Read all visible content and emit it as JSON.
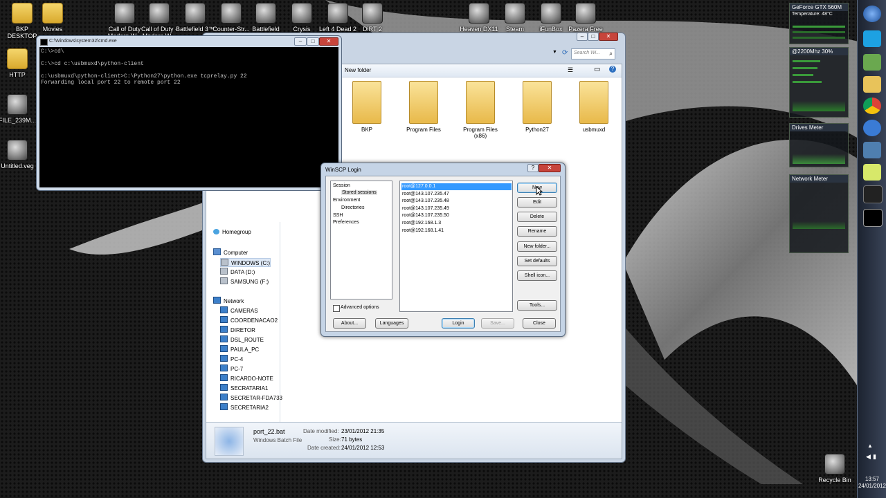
{
  "desktop": {
    "icons": [
      {
        "label": "BKP\nDESKTOP",
        "kind": "folder"
      },
      {
        "label": "Movies",
        "kind": "folder"
      },
      {
        "label": "Call of Duty\nModern W...",
        "kind": "app"
      },
      {
        "label": "Call of Duty -\nModern W...",
        "kind": "app"
      },
      {
        "label": "Battlefield 3™",
        "kind": "app"
      },
      {
        "label": "Counter-Str...",
        "kind": "app"
      },
      {
        "label": "Battlefield",
        "kind": "app"
      },
      {
        "label": "Crysis",
        "kind": "app"
      },
      {
        "label": "Left 4 Dead 2",
        "kind": "app"
      },
      {
        "label": "DiRT 2",
        "kind": "app"
      },
      {
        "label": "Heaven DX11",
        "kind": "app"
      },
      {
        "label": "Steam",
        "kind": "app"
      },
      {
        "label": "iFunBox",
        "kind": "app"
      },
      {
        "label": "Pazera Free\n...",
        "kind": "app"
      },
      {
        "label": "HTTP",
        "kind": "folder"
      },
      {
        "label": "FILE_239M...",
        "kind": "app"
      },
      {
        "label": "Untitled.veg",
        "kind": "app"
      },
      {
        "label": "Recycle Bin",
        "kind": "app"
      }
    ]
  },
  "cmd": {
    "title": "C:\\Windows\\system32\\cmd.exe",
    "lines": "C:\\>cd\\\n\nC:\\>cd c:\\usbmuxd\\python-client\n\nc:\\usbmuxd\\python-client>C:\\Python27\\python.exe tcprelay.py 22\nForwarding local port 22 to remote port 22"
  },
  "explorer": {
    "search_placeholder": "Search Wi...",
    "new_folder": "New folder",
    "folders": [
      "BKP",
      "Program Files",
      "Program Files\n(x86)",
      "Python27",
      "usbmuxd"
    ],
    "nav": {
      "homegroup": "Homegroup",
      "computer": "Computer",
      "drives": [
        "WINDOWS (C:)",
        "DATA (D:)",
        "SAMSUNG (F:)"
      ],
      "network": "Network",
      "hosts": [
        "CAMERAS",
        "COORDENACAO2",
        "DIRETOR",
        "DSL_ROUTE",
        "PAULA_PC",
        "PC-4",
        "PC-7",
        "RICARDO-NOTE",
        "SECRATARIA1",
        "SECRETAR-FDA733",
        "SECRETARIA2"
      ]
    },
    "details": {
      "name": "port_22.bat",
      "type": "Windows Batch File",
      "modified_label": "Date modified:",
      "modified": "23/01/2012 21:35",
      "size_label": "Size:",
      "size": "71 bytes",
      "created_label": "Date created:",
      "created": "24/01/2012 12:53"
    }
  },
  "winscp": {
    "title": "WinSCP Login",
    "tree": {
      "session": "Session",
      "stored": "Stored sessions",
      "environment": "Environment",
      "directories": "Directories",
      "ssh": "SSH",
      "preferences": "Preferences"
    },
    "sessions": [
      "root@127.0.0.1",
      "root@143.107.235.47",
      "root@143.107.235.48",
      "root@143.107.235.49",
      "root@143.107.235.50",
      "root@192.168.1.3",
      "root@192.168.1.41"
    ],
    "selected_index": 0,
    "buttons": {
      "new": "New",
      "edit": "Edit",
      "delete": "Delete",
      "rename": "Rename",
      "new_folder": "New folder...",
      "set_defaults": "Set defaults",
      "shell_icon": "Shell icon...",
      "tools": "Tools...",
      "about": "About...",
      "languages": "Languages",
      "login": "Login",
      "save": "Save...",
      "close": "Close"
    },
    "advanced_options": "Advanced options"
  },
  "gadgets": {
    "gpu": "GeForce GTX 560M",
    "temperature": "Temperature: 48°C",
    "cpu": "@2200Mhz  30%",
    "drives": "Drives Meter",
    "network": "Network Meter"
  },
  "clock": {
    "time": "13:57",
    "date": "24/01/2012"
  }
}
